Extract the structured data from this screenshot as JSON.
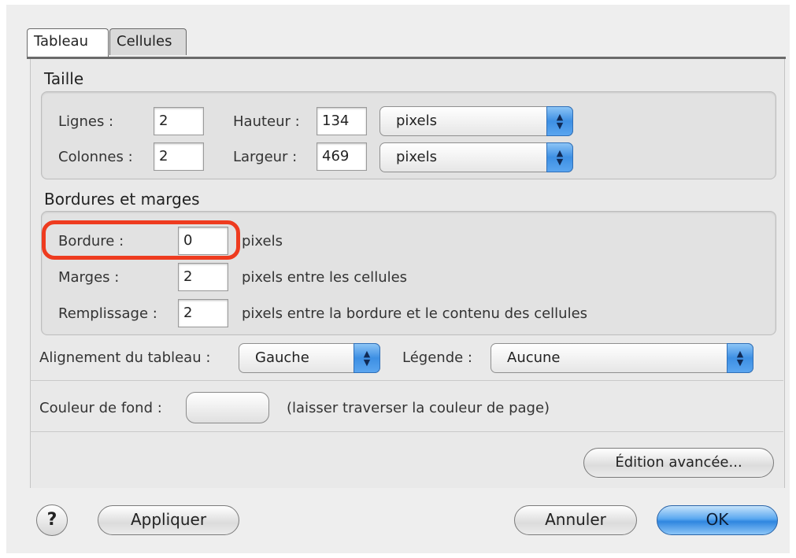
{
  "tabs": [
    {
      "label": "Tableau",
      "active": true
    },
    {
      "label": "Cellules",
      "active": false
    }
  ],
  "taille": {
    "title": "Taille",
    "rows_label": "Lignes :",
    "rows_value": "2",
    "cols_label": "Colonnes :",
    "cols_value": "2",
    "height_label": "Hauteur :",
    "height_value": "134",
    "height_unit": "pixels",
    "width_label": "Largeur :",
    "width_value": "469",
    "width_unit": "pixels"
  },
  "borders": {
    "title": "Bordures et marges",
    "border_label": "Bordure :",
    "border_value": "0",
    "border_suffix": "pixels",
    "margin_label": "Marges :",
    "margin_value": "2",
    "margin_suffix": "pixels entre les cellules",
    "padding_label": "Remplissage :",
    "padding_value": "2",
    "padding_suffix": "pixels entre la bordure et le contenu des cellules"
  },
  "alignment": {
    "label": "Alignement du tableau :",
    "value": "Gauche",
    "caption_label": "Légende :",
    "caption_value": "Aucune"
  },
  "background": {
    "label": "Couleur de fond :",
    "note": "(laisser traverser la couleur de page)"
  },
  "advanced_button": "Édition avancée...",
  "footer": {
    "help": "?",
    "apply": "Appliquer",
    "cancel": "Annuler",
    "ok": "OK"
  },
  "colors": {
    "highlight": "#ee3b1f",
    "ok_button": "#3d8fe3"
  }
}
